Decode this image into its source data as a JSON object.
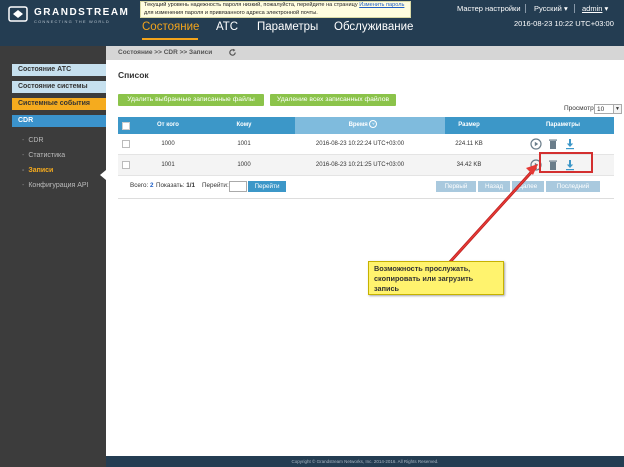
{
  "app": {
    "brand": "GRANDSTREAM",
    "tagline": "CONNECTING THE WORLD"
  },
  "warning": {
    "text1": "Текущий уровень надежность пароля низкий, пожалуйста, перейдите на страницу ",
    "link": "Изменить пароль",
    "text2": " для изменения пароля и привязанного адреса электронной почты."
  },
  "topnav": {
    "items": [
      "Состояние",
      "АТС",
      "Параметры",
      "Обслуживание"
    ]
  },
  "header": {
    "setup_wizard": "Мастер настройки",
    "language": "Русский",
    "user": "admin",
    "datetime": "2016-08-23 10:22 UTC+03:00"
  },
  "sidebar": {
    "items": [
      "Состояние АТС",
      "Состояние системы",
      "Системные события",
      "CDR"
    ],
    "sub_items": [
      "CDR",
      "Статистика",
      "Записи",
      "Конфигурация API"
    ]
  },
  "breadcrumb": "Состояние >> CDR >> Записи",
  "main": {
    "title": "Список",
    "delete_selected": "Удалить выбранные записанные файлы",
    "delete_all": "Удаление всех записанных файлов",
    "viewer_label": "Просмотр:",
    "viewer_value": "10"
  },
  "table": {
    "headers": [
      "От кого",
      "Кому",
      "Время",
      "Размер",
      "Параметры"
    ],
    "rows": [
      {
        "from": "1000",
        "to": "1001",
        "time": "2016-08-23 10:22:24 UTC+03:00",
        "size": "224.11 KB"
      },
      {
        "from": "1001",
        "to": "1000",
        "time": "2016-08-23 10:21:25 UTC+03:00",
        "size": "34.42 KB"
      }
    ]
  },
  "pager": {
    "total_label": "Всего:",
    "total": "2",
    "show_label": "Показать:",
    "show": "1/1",
    "goto_label": "Перейти:",
    "go_button": "Перейти",
    "first": "Первый",
    "prev": "Назад",
    "next": "Далее",
    "last": "Последний"
  },
  "footer": "Copyright © Grandstream Networks, Inc. 2014-2016. All Rights Reserved.",
  "callout": "Возможность прослужать, скопировать или загрузить запись",
  "colors": {
    "header_bg": "#243d52",
    "accent_orange": "#f2a41c",
    "table_header": "#3c97c8",
    "green_button": "#8bc34a",
    "callout_bg": "#fff36e",
    "annotation_red": "#d32f2f"
  }
}
